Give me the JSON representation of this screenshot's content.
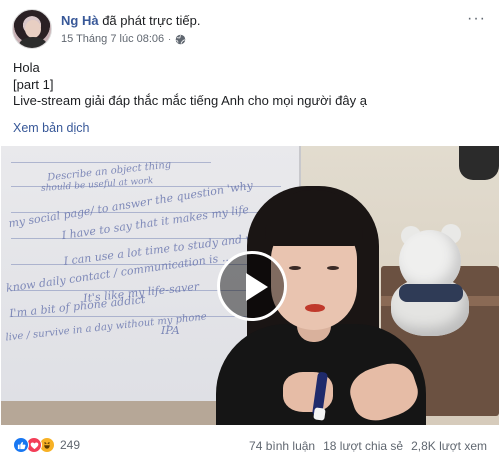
{
  "post": {
    "author": "Ng Hà",
    "action": "đã phát trực tiếp.",
    "timestamp": "15 Tháng 7 lúc 08:06",
    "separator": "·",
    "audience_icon": "globe-icon",
    "more_icon": "more-options-icon",
    "more_glyph": "···",
    "text_lines": [
      "Hola",
      "[part 1]",
      "Live-stream giải đáp thắc mắc tiếng Anh cho mọi người đây ạ"
    ],
    "translate_label": "Xem bản dịch"
  },
  "video": {
    "play_icon": "play-icon",
    "whiteboard_lines": [
      "Describe an object thing",
      "should be useful at work",
      "my social page/ to answer the question 'why",
      "I have to say that it makes my life",
      "I can use a lot time to study and work",
      "know daily contact / communication is ...",
      "It's like my life-saver",
      "I'm a bit of phone addict",
      "live / survive in a day without my phone",
      "IPA"
    ]
  },
  "footer": {
    "reaction_icons": [
      "like-icon",
      "love-icon",
      "haha-icon"
    ],
    "reaction_count": "249",
    "comments": "74 bình luận",
    "shares": "18 lượt chia sẻ",
    "views": "2,8K lượt xem"
  },
  "colors": {
    "link": "#385898",
    "like": "#1877f2",
    "love": "#f33e58",
    "haha": "#f7b125"
  }
}
